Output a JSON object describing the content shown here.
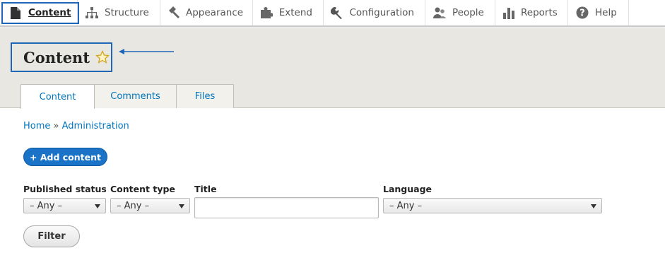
{
  "toolbar": {
    "items": [
      {
        "label": "Content",
        "icon": "file-icon"
      },
      {
        "label": "Structure",
        "icon": "sitemap-icon"
      },
      {
        "label": "Appearance",
        "icon": "paintbrush-icon"
      },
      {
        "label": "Extend",
        "icon": "puzzle-icon"
      },
      {
        "label": "Configuration",
        "icon": "wrench-icon"
      },
      {
        "label": "People",
        "icon": "people-icon"
      },
      {
        "label": "Reports",
        "icon": "bar-chart-icon"
      },
      {
        "label": "Help",
        "icon": "help-icon"
      }
    ]
  },
  "page": {
    "title": "Content"
  },
  "tabs": [
    {
      "label": "Content"
    },
    {
      "label": "Comments"
    },
    {
      "label": "Files"
    }
  ],
  "breadcrumb": {
    "home": "Home",
    "separator": "»",
    "admin": "Administration"
  },
  "actions": {
    "add_content": "+ Add content"
  },
  "filters": {
    "published_status": {
      "label": "Published status",
      "value": "– Any –"
    },
    "content_type": {
      "label": "Content type",
      "value": "– Any –"
    },
    "title": {
      "label": "Title",
      "value": ""
    },
    "language": {
      "label": "Language",
      "value": "– Any –"
    },
    "submit": "Filter"
  },
  "colors": {
    "accent": "#1f66b7",
    "link": "#0074bd",
    "header_band": "#e8e7e2"
  }
}
